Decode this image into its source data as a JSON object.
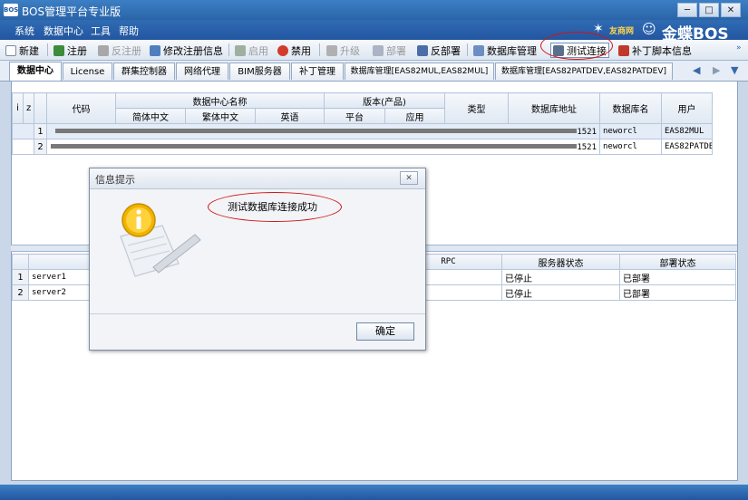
{
  "window": {
    "title": "BOS管理平台专业版",
    "icon_text": "BOS",
    "controls": [
      "─",
      "□",
      "✕"
    ]
  },
  "menu": {
    "items": [
      "系统",
      "数据中心",
      "工具",
      "帮助"
    ]
  },
  "brand": {
    "left_text": "友商网",
    "right_text": "金蝶BOS"
  },
  "toolbar": {
    "new": "新建",
    "register": "注册",
    "unregister": "反注册",
    "edit_register": "修改注册信息",
    "enable": "启用",
    "disable": "禁用",
    "upgrade": "升级",
    "deploy": "部署",
    "undeploy": "反部署",
    "db_manage": "数据库管理",
    "test_conn": "测试连接",
    "patch_info": "补丁脚本信息"
  },
  "tabs": [
    {
      "label": "数据中心",
      "active": true
    },
    {
      "label": "License",
      "active": false
    },
    {
      "label": "群集控制器",
      "active": false
    },
    {
      "label": "网络代理",
      "active": false
    },
    {
      "label": "BIM服务器",
      "active": false
    },
    {
      "label": "补丁管理",
      "active": false
    },
    {
      "label": "数据库管理[EAS82MUL,EAS82MUL]",
      "active": false
    },
    {
      "label": "数据库管理[EAS82PATDEV,EAS82PATDEV]",
      "active": false
    }
  ],
  "tab_nav": {
    "prev": "◀",
    "next": "▶",
    "more": "▼"
  },
  "datacenter_table": {
    "corner": [
      "i",
      "z"
    ],
    "headers": {
      "code": "代码",
      "name_group": "数据中心名称",
      "simplified": "简体中文",
      "traditional": "繁体中文",
      "english": "英语",
      "version_group": "版本(产品)",
      "platform": "平台",
      "app": "应用",
      "type": "类型",
      "db_address": "数据库地址",
      "db_name": "数据库名",
      "user": "用户"
    },
    "rows": [
      {
        "no": "1",
        "port": "1521",
        "db_name": "neworcl",
        "user": "EAS82MUL"
      },
      {
        "no": "2",
        "port": "1521",
        "db_name": "neworcl",
        "user": "EAS82PATDEV"
      }
    ]
  },
  "server_table": {
    "headers": {
      "instance": "实",
      "rpc": "RPC",
      "server_status": "服务器状态",
      "deploy_status": "部署状态"
    },
    "rows": [
      {
        "no": "1",
        "name": "server1",
        "server_status": "已停止",
        "deploy_status": "已部署"
      },
      {
        "no": "2",
        "name": "server2",
        "server_status": "已停止",
        "deploy_status": "已部署"
      }
    ]
  },
  "dialog": {
    "title": "信息提示",
    "close": "✕",
    "message": "测试数据库连接成功",
    "ok": "确定"
  },
  "colors": {
    "titlebar": "#2a64a8",
    "highlight_circle": "#d01515",
    "selected_row": "#e3ecf7"
  }
}
